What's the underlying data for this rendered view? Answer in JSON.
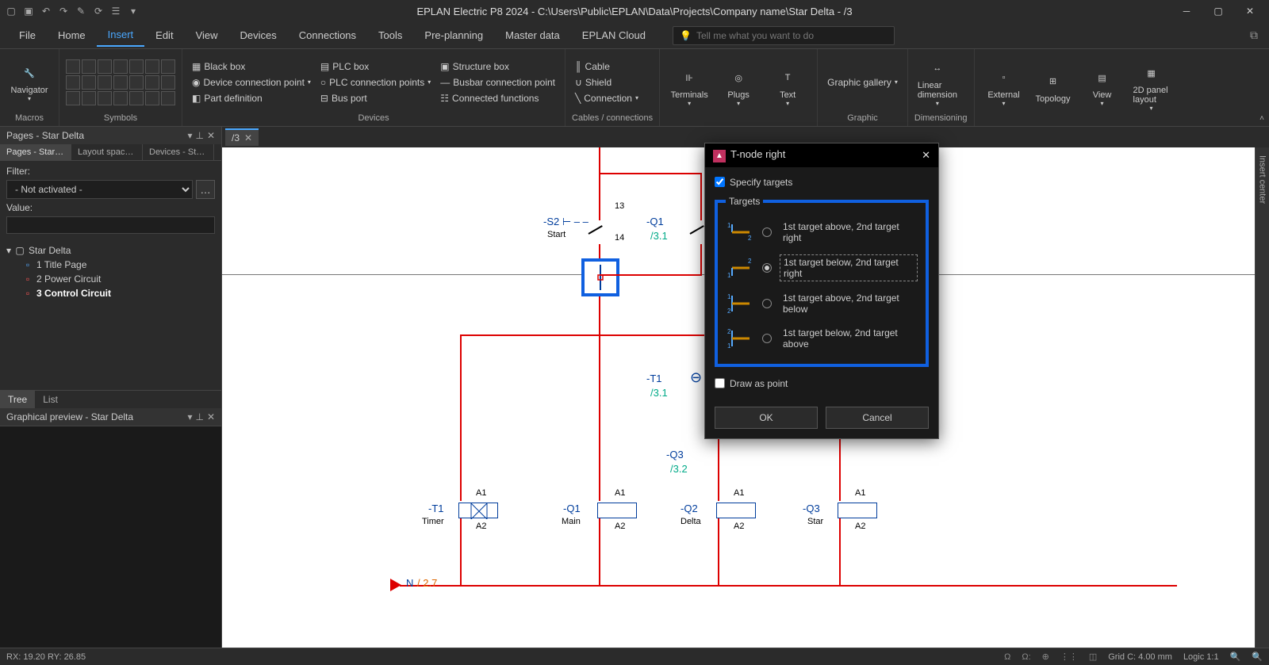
{
  "titlebar": {
    "title": "EPLAN Electric P8 2024 - C:\\Users\\Public\\EPLAN\\Data\\Projects\\Company name\\Star Delta - /3"
  },
  "menubar": {
    "items": [
      "File",
      "Home",
      "Insert",
      "Edit",
      "View",
      "Devices",
      "Connections",
      "Tools",
      "Pre-planning",
      "Master data",
      "EPLAN Cloud"
    ],
    "active_index": 2,
    "search_placeholder": "Tell me what you want to do"
  },
  "ribbon": {
    "groups": [
      {
        "label": "Macros",
        "big": [
          {
            "label": "Navigator"
          }
        ]
      },
      {
        "label": "Symbols"
      },
      {
        "label": "Devices",
        "cols": [
          [
            "Black box",
            "Device connection point",
            "Part definition"
          ],
          [
            "PLC box",
            "PLC connection points",
            "Bus port"
          ],
          [
            "Structure box",
            "Busbar connection point",
            "Connected functions"
          ]
        ]
      },
      {
        "label": "Cables / connections",
        "cols": [
          [
            "Cable",
            "Shield",
            "Connection"
          ]
        ]
      },
      {
        "label": "",
        "big": [
          {
            "label": "Terminals"
          },
          {
            "label": "Plugs"
          },
          {
            "label": "Text"
          }
        ]
      },
      {
        "label": "Graphic",
        "items": [
          "Graphic gallery"
        ]
      },
      {
        "label": "Dimensioning",
        "big": [
          {
            "label": "Linear dimension"
          }
        ]
      },
      {
        "label": "",
        "big": [
          {
            "label": "External"
          },
          {
            "label": "Topology"
          },
          {
            "label": "View"
          },
          {
            "label": "2D panel layout"
          }
        ]
      }
    ]
  },
  "left_panel": {
    "pages_title": "Pages - Star Delta",
    "tabs": [
      "Pages - Star D...",
      "Layout space - ...",
      "Devices - Star ..."
    ],
    "filter_label": "Filter:",
    "filter_value": "- Not activated -",
    "value_label": "Value:",
    "tree": {
      "root": "Star Delta",
      "children": [
        {
          "label": "1 Title Page"
        },
        {
          "label": "2 Power Circuit"
        },
        {
          "label": "3 Control Circuit",
          "bold": true
        }
      ]
    },
    "bottom_tabs": [
      "Tree",
      "List"
    ],
    "preview_title": "Graphical preview - Star Delta"
  },
  "doc_tab": "/3",
  "schematic": {
    "components": {
      "s2": {
        "tag": "-S2",
        "desc": "Start",
        "pin_top": "13",
        "pin_bot": "14"
      },
      "q1_contact": {
        "tag": "-Q1",
        "xref": "/3.1"
      },
      "t1_contact": {
        "tag": "-T1",
        "xref": "/3.1"
      },
      "q3_contact": {
        "tag": "-Q3",
        "xref": "/3.2"
      },
      "coils": [
        {
          "tag": "-T1",
          "desc": "Timer",
          "a1": "A1",
          "a2": "A2"
        },
        {
          "tag": "-Q1",
          "desc": "Main",
          "a1": "A1",
          "a2": "A2"
        },
        {
          "tag": "-Q2",
          "desc": "Delta",
          "a1": "A1",
          "a2": "A2"
        },
        {
          "tag": "-Q3",
          "desc": "Star",
          "a1": "A1",
          "a2": "A2"
        }
      ],
      "neutral": {
        "label": "N",
        "xref": "/ 2.7"
      }
    }
  },
  "dialog": {
    "title": "T-node right",
    "specify_targets": "Specify targets",
    "targets_legend": "Targets",
    "options": [
      "1st target above, 2nd target right",
      "1st target below, 2nd target right",
      "1st target above, 2nd target below",
      "1st target below, 2nd target above"
    ],
    "selected_index": 1,
    "draw_as_point": "Draw as point",
    "ok": "OK",
    "cancel": "Cancel"
  },
  "statusbar": {
    "coords": "RX: 19.20 RY: 26.85",
    "grid": "Grid C: 4.00 mm",
    "logic": "Logic 1:1"
  },
  "right_sidebar": {
    "label": "Insert center"
  }
}
